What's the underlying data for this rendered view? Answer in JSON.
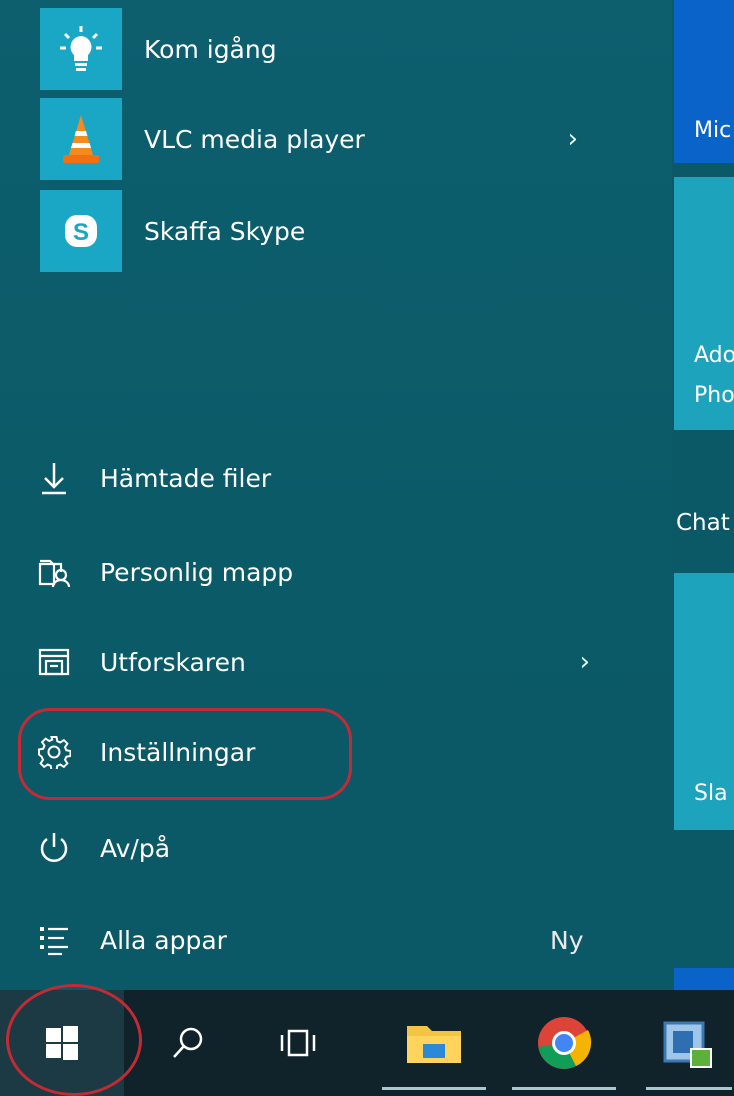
{
  "apps": [
    {
      "label": "Kom igång",
      "icon": "lightbulb-icon",
      "tile_color": "#1aa7c6"
    },
    {
      "label": "VLC media player",
      "icon": "vlc-cone-icon",
      "tile_color": "#1aa7c6",
      "has_submenu": true,
      "chevron": "›"
    },
    {
      "label": "Skaffa Skype",
      "icon": "skype-icon",
      "tile_color": "#1aa7c6"
    }
  ],
  "system": [
    {
      "label": "Hämtade filer",
      "icon": "download-icon"
    },
    {
      "label": "Personlig mapp",
      "icon": "user-folder-icon"
    },
    {
      "label": "Utforskaren",
      "icon": "file-explorer-icon",
      "has_submenu": true,
      "chevron": "›"
    },
    {
      "label": "Inställningar",
      "icon": "gear-icon",
      "highlighted": true
    },
    {
      "label": "Av/på",
      "icon": "power-icon"
    },
    {
      "label": "Alla appar",
      "icon": "list-icon",
      "badge": "Ny"
    }
  ],
  "tiles": {
    "mic_label": "Mic",
    "adobe_line1": "Ado",
    "adobe_line2": "Pho",
    "chat_label": "Chat",
    "slack_label": "Sla"
  },
  "taskbar": {
    "items": [
      "start-button",
      "search-button",
      "task-view-button",
      "file-explorer-button",
      "chrome-button",
      "app-button"
    ]
  },
  "colors": {
    "panel": "#0b5a68",
    "tile": "#1ea3bd",
    "accent_blue": "#0a63c9",
    "highlight_ring": "#c22b35",
    "taskbar": "#10222a"
  }
}
